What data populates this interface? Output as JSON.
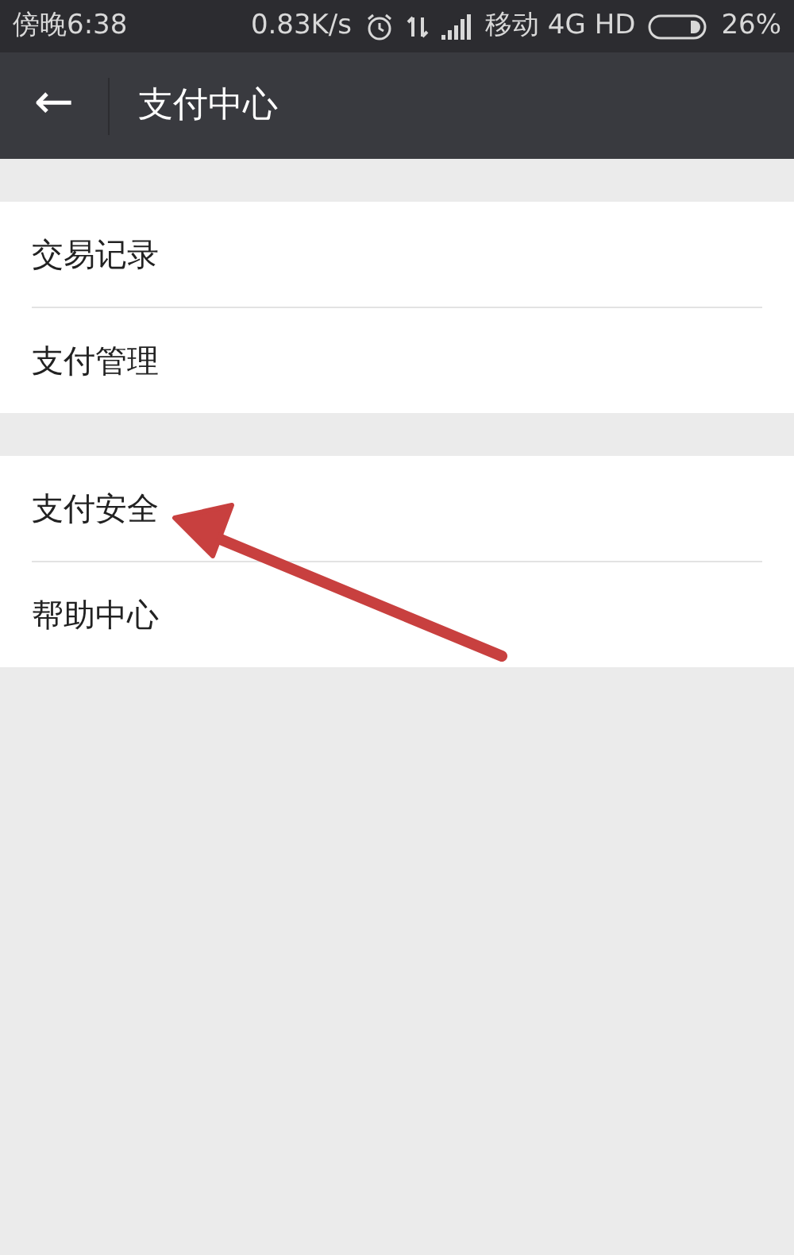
{
  "status_bar": {
    "time": "傍晚6:38",
    "speed": "0.83K/s",
    "carrier": "移动 4G HD",
    "battery": "26%"
  },
  "header": {
    "back": "←",
    "title": "支付中心"
  },
  "groups": [
    {
      "items": [
        {
          "label": "交易记录"
        },
        {
          "label": "支付管理"
        }
      ]
    },
    {
      "items": [
        {
          "label": "支付安全"
        },
        {
          "label": "帮助中心"
        }
      ]
    }
  ],
  "annotation": {
    "kind": "arrow"
  }
}
